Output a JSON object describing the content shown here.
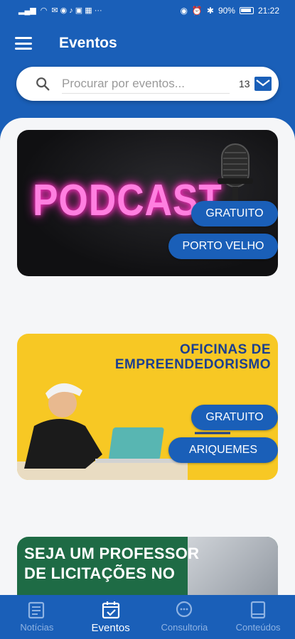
{
  "status": {
    "battery": "90%",
    "time": "21:22"
  },
  "header": {
    "title": "Eventos"
  },
  "search": {
    "placeholder": "Procurar por eventos...",
    "count": "13"
  },
  "events": [
    {
      "image_text": "PODCAST",
      "price_tag": "GRATUITO",
      "city_tag": "PORTO VELHO"
    },
    {
      "image_text_line1": "OFICINAS DE",
      "image_text_line2": "EMPREENDEDORISMO",
      "price_tag": "GRATUITO",
      "city_tag": "ARIQUEMES"
    },
    {
      "image_text_line1": "SEJA UM PROFESSOR",
      "image_text_line2": "DE LICITAÇÕES NO"
    }
  ],
  "bottom_nav": {
    "items": [
      {
        "label": "Notícias",
        "icon": "newspaper-icon"
      },
      {
        "label": "Eventos",
        "icon": "calendar-check-icon"
      },
      {
        "label": "Consultoria",
        "icon": "chat-bubbles-icon"
      },
      {
        "label": "Conteúdos",
        "icon": "book-icon"
      }
    ],
    "active": "Eventos"
  },
  "colors": {
    "primary": "#1a5fb8",
    "background": "#f5f6f8",
    "nav_inactive": "#8fb3e3"
  }
}
